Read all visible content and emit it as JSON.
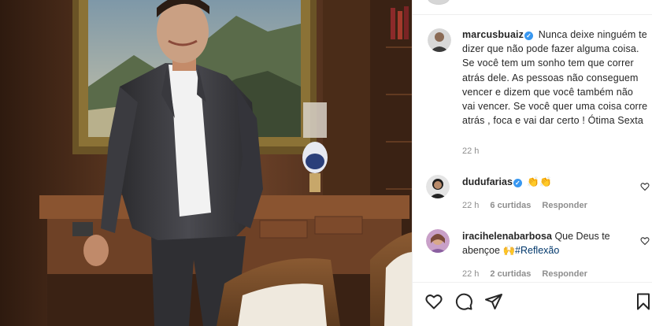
{
  "post": {
    "author": {
      "username": "marcusbuaiz",
      "verified": true
    },
    "caption": "Nunca deixe ninguém te dizer que não pode fazer alguma coisa. Se você tem um sonho tem que correr atrás dele. As pessoas não conseguem vencer e dizem que você também não vai vencer. Se você quer uma coisa corre atrás , foca e vai dar certo ! Ótima Sexta",
    "caption_time": "22 h"
  },
  "comments": [
    {
      "username": "dudufarias",
      "verified": true,
      "text": "👏👏",
      "time": "22 h",
      "likes": "6 curtidas",
      "reply": "Responder"
    },
    {
      "username": "iracihelenabarbosa",
      "verified": false,
      "text": "Que Deus te abençoe",
      "emoji": "🙌",
      "hashtag": "#Reflexão",
      "time": "22 h",
      "likes": "2 curtidas",
      "reply": "Responder"
    }
  ],
  "actions": [
    "heart-icon",
    "comment-icon",
    "share-icon",
    "bookmark-icon"
  ],
  "colors": {
    "text": "#262626",
    "secondary": "#8e8e8e",
    "verified": "#3897f0",
    "link": "#00376b"
  }
}
